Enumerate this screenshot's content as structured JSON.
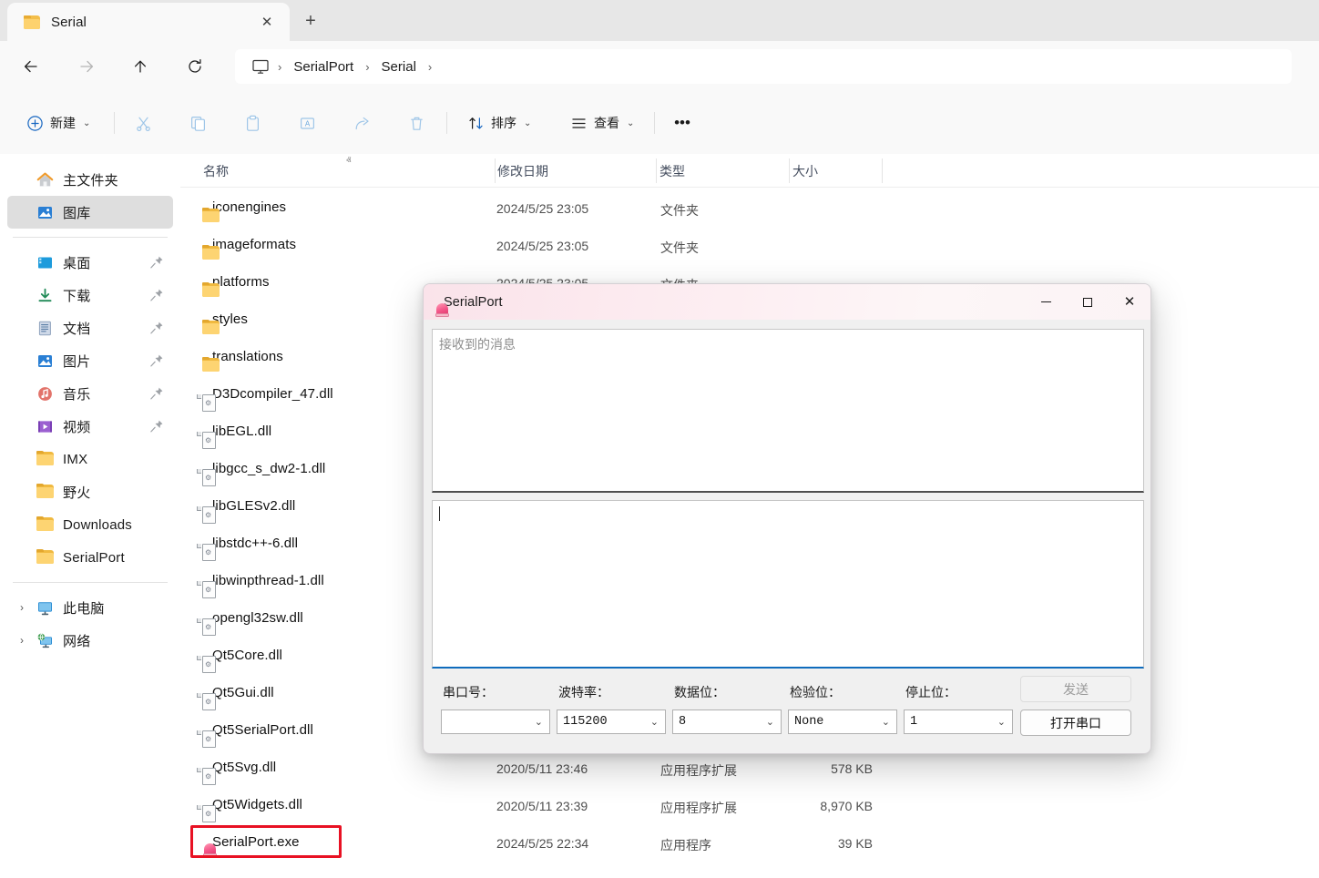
{
  "window": {
    "tab": {
      "title": "Serial",
      "icon": "folder-icon",
      "close_label": "✕"
    },
    "new_tab_label": "+"
  },
  "nav": {
    "back": "←",
    "forward": "→",
    "up": "↑",
    "refresh": "↻",
    "breadcrumb": {
      "root_icon": "this-pc-icon",
      "items": [
        "SerialPort",
        "Serial"
      ],
      "separator": "›"
    }
  },
  "toolbar": {
    "new_label": "新建",
    "cut_label": "",
    "copy_label": "",
    "paste_label": "",
    "rename_label": "",
    "share_label": "",
    "delete_label": "",
    "sort_label": "排序",
    "view_label": "查看",
    "more_label": "•••",
    "chevron": "⌄"
  },
  "sidebar": {
    "items": [
      {
        "label": "主文件夹",
        "icon": "home-icon",
        "selected": false,
        "pinned": false
      },
      {
        "label": "图库",
        "icon": "gallery-icon",
        "selected": true,
        "pinned": false
      }
    ],
    "quick_access": [
      {
        "label": "桌面",
        "icon": "desktop-icon",
        "pinned": true
      },
      {
        "label": "下载",
        "icon": "downloads-icon",
        "pinned": true
      },
      {
        "label": "文档",
        "icon": "documents-icon",
        "pinned": true
      },
      {
        "label": "图片",
        "icon": "pictures-icon",
        "pinned": true
      },
      {
        "label": "音乐",
        "icon": "music-icon",
        "pinned": true
      },
      {
        "label": "视频",
        "icon": "videos-icon",
        "pinned": true
      },
      {
        "label": "IMX",
        "icon": "folder-icon",
        "pinned": false
      },
      {
        "label": "野火",
        "icon": "folder-icon",
        "pinned": false
      },
      {
        "label": "Downloads",
        "icon": "folder-icon",
        "pinned": false
      },
      {
        "label": "SerialPort",
        "icon": "folder-icon",
        "pinned": false
      }
    ],
    "tree": [
      {
        "label": "此电脑",
        "icon": "this-pc-icon",
        "chevron": "›"
      },
      {
        "label": "网络",
        "icon": "network-icon",
        "chevron": "›"
      }
    ]
  },
  "file_list": {
    "columns": [
      {
        "label": "名称",
        "sort_indicator": "ⱏ"
      },
      {
        "label": "修改日期"
      },
      {
        "label": "类型"
      },
      {
        "label": "大小"
      }
    ],
    "rows": [
      {
        "name": "iconengines",
        "icon": "folder-icon",
        "date": "2024/5/25 23:05",
        "type": "文件夹",
        "size": ""
      },
      {
        "name": "imageformats",
        "icon": "folder-icon",
        "date": "2024/5/25 23:05",
        "type": "文件夹",
        "size": ""
      },
      {
        "name": "platforms",
        "icon": "folder-icon",
        "date": "2024/5/25 23:05",
        "type": "文件夹",
        "size": ""
      },
      {
        "name": "styles",
        "icon": "folder-icon",
        "date": "",
        "type": "",
        "size": ""
      },
      {
        "name": "translations",
        "icon": "folder-icon",
        "date": "",
        "type": "",
        "size": ""
      },
      {
        "name": "D3Dcompiler_47.dll",
        "icon": "dll-icon",
        "date": "",
        "type": "",
        "size": ""
      },
      {
        "name": "libEGL.dll",
        "icon": "dll-icon",
        "date": "",
        "type": "",
        "size": ""
      },
      {
        "name": "libgcc_s_dw2-1.dll",
        "icon": "dll-icon",
        "date": "",
        "type": "",
        "size": ""
      },
      {
        "name": "libGLESv2.dll",
        "icon": "dll-icon",
        "date": "",
        "type": "",
        "size": ""
      },
      {
        "name": "libstdc++-6.dll",
        "icon": "dll-icon",
        "date": "",
        "type": "",
        "size": ""
      },
      {
        "name": "libwinpthread-1.dll",
        "icon": "dll-icon",
        "date": "",
        "type": "",
        "size": ""
      },
      {
        "name": "opengl32sw.dll",
        "icon": "dll-icon",
        "date": "",
        "type": "",
        "size": ""
      },
      {
        "name": "Qt5Core.dll",
        "icon": "dll-icon",
        "date": "",
        "type": "",
        "size": ""
      },
      {
        "name": "Qt5Gui.dll",
        "icon": "dll-icon",
        "date": "",
        "type": "",
        "size": ""
      },
      {
        "name": "Qt5SerialPort.dll",
        "icon": "dll-icon",
        "date": "",
        "type": "",
        "size": ""
      },
      {
        "name": "Qt5Svg.dll",
        "icon": "dll-icon",
        "date": "2020/5/11 23:46",
        "type": "应用程序扩展",
        "size": "578 KB"
      },
      {
        "name": "Qt5Widgets.dll",
        "icon": "dll-icon",
        "date": "2020/5/11 23:39",
        "type": "应用程序扩展",
        "size": "8,970 KB"
      },
      {
        "name": "SerialPort.exe",
        "icon": "siren-icon",
        "date": "2024/5/25 22:34",
        "type": "应用程序",
        "size": "39 KB",
        "highlighted": true
      }
    ],
    "highlight_color": "#e81123"
  },
  "dialog": {
    "title": "SerialPort",
    "app_icon": "siren-icon",
    "controls": {
      "minimize": "—",
      "maximize": "□",
      "close": "✕"
    },
    "receive_placeholder": "接收到的消息",
    "send_value": "",
    "fields": [
      {
        "label": "串口号：",
        "value": "",
        "name": "port-select"
      },
      {
        "label": "波特率：",
        "value": "115200",
        "name": "baud-select"
      },
      {
        "label": "数据位：",
        "value": "8",
        "name": "databits-select"
      },
      {
        "label": "检验位：",
        "value": "None",
        "name": "parity-select"
      },
      {
        "label": "停止位：",
        "value": "1",
        "name": "stopbits-select"
      }
    ],
    "send_button": "发送",
    "open_button": "打开串口",
    "send_button_enabled": false,
    "accent_color": "#0f6cbd",
    "titlebar_color": "#fae3ea"
  }
}
